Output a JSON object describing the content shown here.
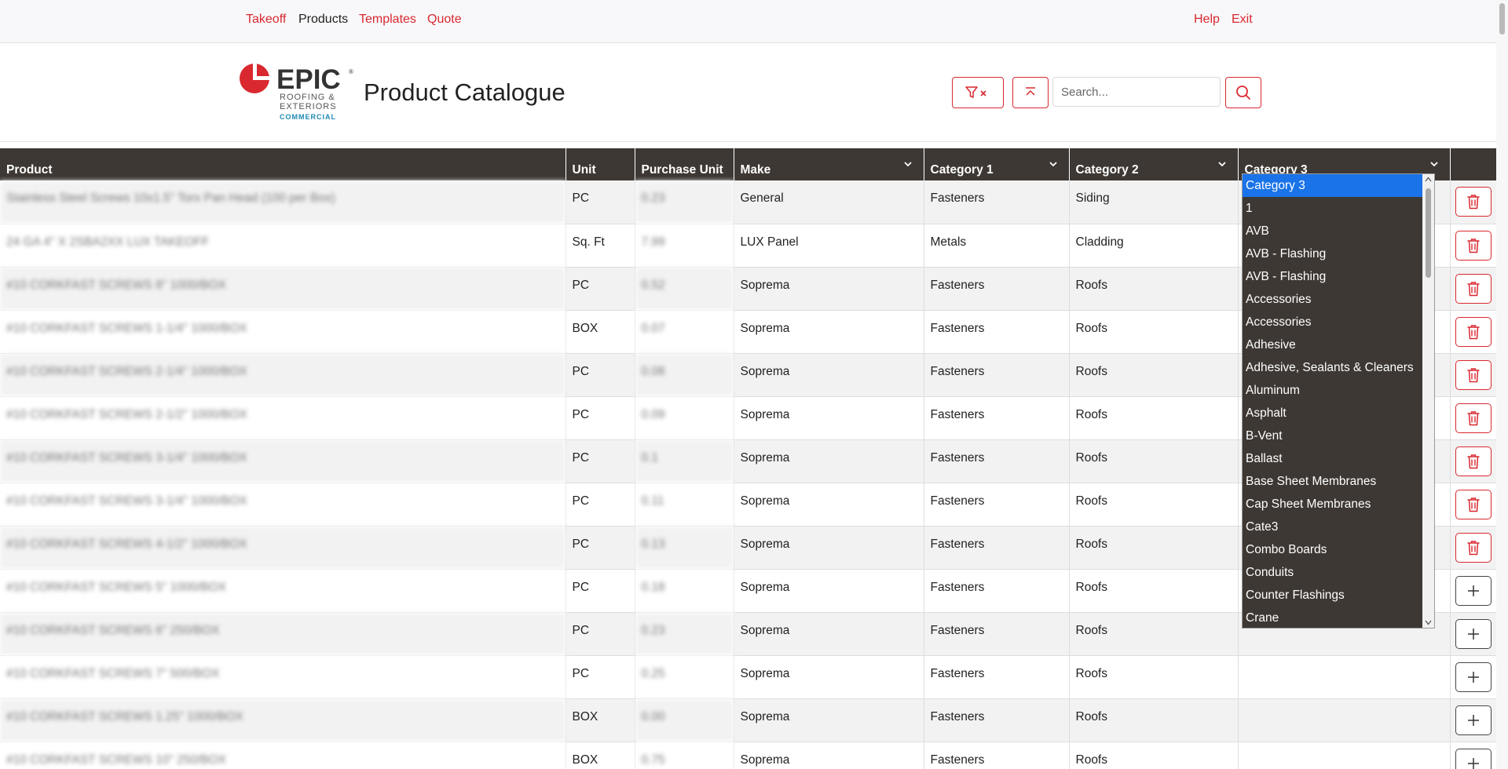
{
  "nav": {
    "takeoff": "Takeoff",
    "products": "Products",
    "templates": "Templates",
    "quote": "Quote",
    "help": "Help",
    "exit": "Exit"
  },
  "logo": {
    "word": "EPIC",
    "registered": "®",
    "line1": "ROOFING &",
    "line2": "EXTERIORS",
    "line3": "COMMERCIAL"
  },
  "header": {
    "title": "Product Catalogue",
    "filter_clear_icon": "filter-clear-icon",
    "scroll_top_icon": "scroll-top-icon",
    "search_icon": "search-icon"
  },
  "search": {
    "placeholder": "Search..."
  },
  "table": {
    "columns": {
      "product": "Product",
      "unit": "Unit",
      "purchase_unit": "Purchase Unit",
      "make": "Make",
      "category1": "Category 1",
      "category2": "Category 2",
      "category3": "Category 3"
    },
    "rows": [
      {
        "product": "Stainless Steel Screws 10x1.5\" Torx Pan Head (100 per Box)",
        "unit": "PC",
        "purchase_unit": "0.23",
        "make": "General",
        "category1": "Fasteners",
        "category2": "Siding",
        "category3": "",
        "action": "delete"
      },
      {
        "product": "24 GA 4\" X 2SBA2XX LUX TAKEOFF",
        "unit": "Sq. Ft",
        "purchase_unit": "7.99",
        "make": "LUX Panel",
        "category1": "Metals",
        "category2": "Cladding",
        "category3": "",
        "action": "delete"
      },
      {
        "product": "#10 CORKFAST SCREWS 8\" 1000/BOX",
        "unit": "PC",
        "purchase_unit": "0.52",
        "make": "Soprema",
        "category1": "Fasteners",
        "category2": "Roofs",
        "category3": "",
        "action": "delete"
      },
      {
        "product": "#10 CORKFAST SCREWS 1-1/4\" 1000/BOX",
        "unit": "BOX",
        "purchase_unit": "0.07",
        "make": "Soprema",
        "category1": "Fasteners",
        "category2": "Roofs",
        "category3": "",
        "action": "delete"
      },
      {
        "product": "#10 CORKFAST SCREWS 2-1/4\" 1000/BOX",
        "unit": "PC",
        "purchase_unit": "0.08",
        "make": "Soprema",
        "category1": "Fasteners",
        "category2": "Roofs",
        "category3": "",
        "action": "delete"
      },
      {
        "product": "#10 CORKFAST SCREWS 2-1/2\" 1000/BOX",
        "unit": "PC",
        "purchase_unit": "0.09",
        "make": "Soprema",
        "category1": "Fasteners",
        "category2": "Roofs",
        "category3": "",
        "action": "delete"
      },
      {
        "product": "#10 CORKFAST SCREWS 3-1/4\" 1000/BOX",
        "unit": "PC",
        "purchase_unit": "0.1",
        "make": "Soprema",
        "category1": "Fasteners",
        "category2": "Roofs",
        "category3": "",
        "action": "delete"
      },
      {
        "product": "#10 CORKFAST SCREWS 3-1/4\" 1000/BOX",
        "unit": "PC",
        "purchase_unit": "0.11",
        "make": "Soprema",
        "category1": "Fasteners",
        "category2": "Roofs",
        "category3": "",
        "action": "delete"
      },
      {
        "product": "#10 CORKFAST SCREWS 4-1/2\" 1000/BOX",
        "unit": "PC",
        "purchase_unit": "0.13",
        "make": "Soprema",
        "category1": "Fasteners",
        "category2": "Roofs",
        "category3": "",
        "action": "delete"
      },
      {
        "product": "#10 CORKFAST SCREWS 5\" 1000/BOX",
        "unit": "PC",
        "purchase_unit": "0.18",
        "make": "Soprema",
        "category1": "Fasteners",
        "category2": "Roofs",
        "category3": "",
        "action": "add"
      },
      {
        "product": "#10 CORKFAST SCREWS 6\" 250/BOX",
        "unit": "PC",
        "purchase_unit": "0.23",
        "make": "Soprema",
        "category1": "Fasteners",
        "category2": "Roofs",
        "category3": "",
        "action": "add"
      },
      {
        "product": "#10 CORKFAST SCREWS 7\" 500/BOX",
        "unit": "PC",
        "purchase_unit": "0.25",
        "make": "Soprema",
        "category1": "Fasteners",
        "category2": "Roofs",
        "category3": "",
        "action": "add"
      },
      {
        "product": "#10 CORKFAST SCREWS 1.25\" 1000/BOX",
        "unit": "BOX",
        "purchase_unit": "0.00",
        "make": "Soprema",
        "category1": "Fasteners",
        "category2": "Roofs",
        "category3": "",
        "action": "add"
      },
      {
        "product": "#10 CORKFAST SCREWS 10\" 250/BOX",
        "unit": "BOX",
        "purchase_unit": "0.75",
        "make": "Soprema",
        "category1": "Fasteners",
        "category2": "Roofs",
        "category3": "",
        "action": "add"
      }
    ]
  },
  "dropdown": {
    "selected_index": 0,
    "options": [
      "Category 3",
      "1",
      "AVB",
      "AVB - Flashing",
      "AVB - Flashing",
      "Accessories",
      "Accessories",
      "Adhesive",
      "Adhesive, Sealants & Cleaners",
      "Aluminum",
      "Asphalt",
      "B-Vent",
      "Ballast",
      "Base Sheet Membranes",
      "Cap Sheet Membranes",
      "Cate3",
      "Combo Boards",
      "Conduits",
      "Counter Flashings",
      "Crane"
    ]
  },
  "colors": {
    "accent": "#d9282f",
    "header_bg": "#3d3834",
    "logo_blue": "#1f8ab3",
    "selected_option": "#1a73e8"
  }
}
